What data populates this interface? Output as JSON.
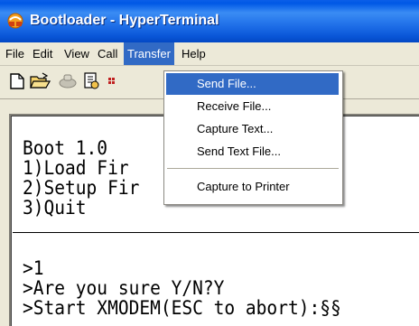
{
  "window": {
    "title": "Bootloader - HyperTerminal",
    "accent_color": "#316ac5",
    "titlebar_color": "#0058e6"
  },
  "menubar": {
    "items": [
      {
        "label": "File"
      },
      {
        "label": "Edit"
      },
      {
        "label": "View"
      },
      {
        "label": "Call"
      },
      {
        "label": "Transfer"
      },
      {
        "label": "Help"
      }
    ],
    "active": "Transfer"
  },
  "toolbar": {
    "icons": [
      "new-icon",
      "open-icon",
      "disconnect-icon",
      "properties-icon",
      "send-icon"
    ]
  },
  "transfer_menu": {
    "items": [
      {
        "label": "Send File..."
      },
      {
        "label": "Receive File..."
      },
      {
        "label": "Capture Text..."
      },
      {
        "label": "Send Text File..."
      },
      {
        "label": "Capture to Printer"
      }
    ],
    "highlighted": "Send File..."
  },
  "terminal": {
    "lines": [
      "Boot 1.0",
      "1)Load Fir",
      "2)Setup Fir",
      "3)Quit",
      "",
      ">1",
      ">Are you sure Y/N?Y",
      ">Start XMODEM(ESC to abort):§§"
    ]
  }
}
